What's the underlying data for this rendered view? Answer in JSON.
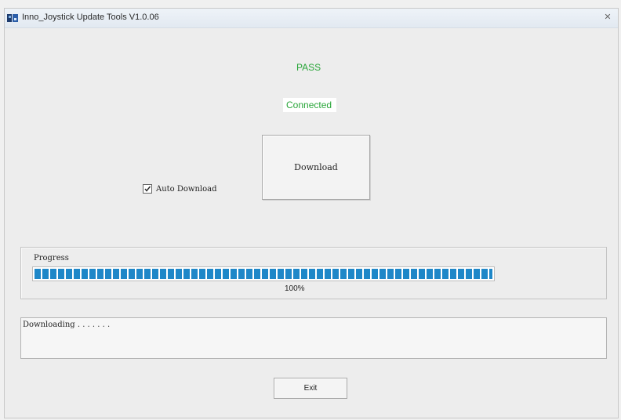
{
  "window": {
    "title": "Inno_Joystick Update Tools V1.0.06",
    "close_glyph": "✕"
  },
  "status": {
    "result": "PASS",
    "connection": "Connected",
    "status_color": "#2aa63a"
  },
  "actions": {
    "download_label": "Download",
    "exit_label": "Exit"
  },
  "options": {
    "auto_download_label": "Auto Download",
    "auto_download_checked": true
  },
  "progress": {
    "legend": "Progress",
    "value_percent": 100,
    "percent_text": "100%",
    "fill_color": "#1e87c8"
  },
  "log": {
    "text": "Downloading . . . . . . ."
  },
  "icons": {
    "app": "joystick-app-icon",
    "close": "close-icon",
    "check": "checkmark-icon"
  }
}
